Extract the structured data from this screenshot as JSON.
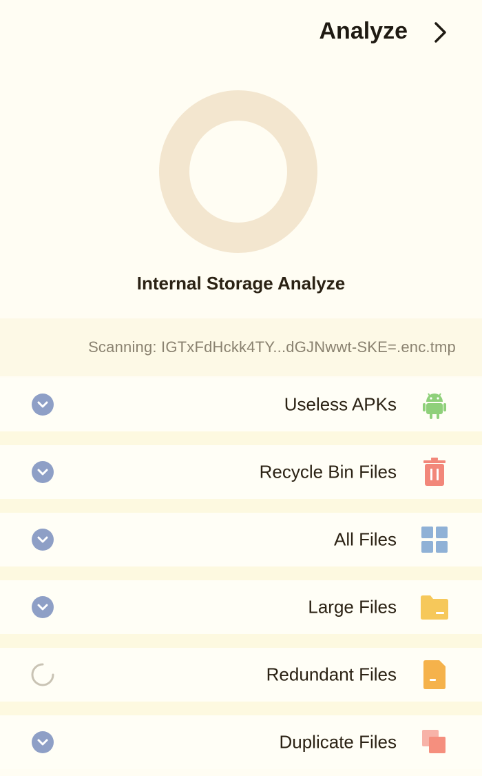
{
  "header": {
    "title": "Analyze"
  },
  "ring": {
    "label": "Internal Storage Analyze",
    "color": "#f3e6cf"
  },
  "scan": {
    "text": "Scanning: IGTxFdHckk4TY...dGJNwwt-SKE=.enc.tmp"
  },
  "items": [
    {
      "label": "Useless APKs",
      "icon": "android-icon",
      "status": "done"
    },
    {
      "label": "Recycle Bin Files",
      "icon": "trash-icon",
      "status": "done"
    },
    {
      "label": "All Files",
      "icon": "grid-icon",
      "status": "done"
    },
    {
      "label": "Large Files",
      "icon": "folder-icon",
      "status": "done"
    },
    {
      "label": "Redundant Files",
      "icon": "document-icon",
      "status": "loading"
    },
    {
      "label": "Duplicate Files",
      "icon": "duplicate-icon",
      "status": "done"
    }
  ],
  "colors": {
    "accent": "#8e9fc6",
    "android": "#8fd07a",
    "trash": "#f2877a",
    "grid": "#8fb1d6",
    "folder": "#f6c85a",
    "document": "#f5b24b",
    "duplicate": "#f58f7e"
  }
}
